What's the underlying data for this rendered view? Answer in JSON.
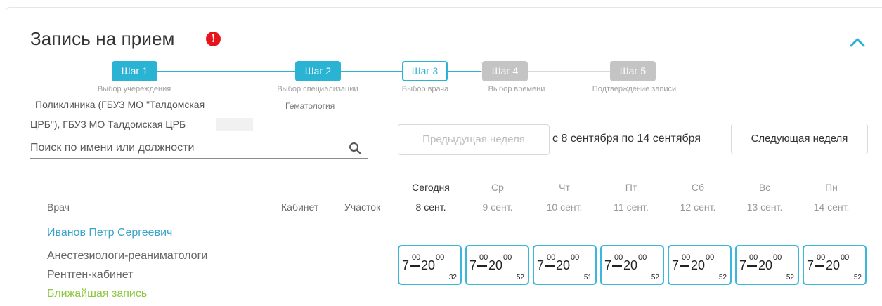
{
  "header": {
    "title": "Запись на прием",
    "info_icon": "info-icon",
    "collapse_icon": "chevron-up-icon",
    "accent_color": "#2bb3d4",
    "info_color": "#e8141c"
  },
  "steps": [
    {
      "label": "Шаг 1",
      "caption": "Выбор учереждения",
      "state": "done"
    },
    {
      "label": "Шаг 2",
      "caption": "Выбор специализации",
      "state": "done"
    },
    {
      "label": "Шаг 3",
      "caption": "Выбор врача",
      "state": "current"
    },
    {
      "label": "Шаг 4",
      "caption": "Выбор времени",
      "state": "todo"
    },
    {
      "label": "Шаг 5",
      "caption": "Подтверждение записи",
      "state": "todo"
    }
  ],
  "selection": {
    "clinic_line1": "Поликлиника (ГБУЗ МО \"Талдомская",
    "clinic_line2": "ЦРБ\"), ГБУЗ МО Талдомская ЦРБ",
    "specialization": "Гематология"
  },
  "search": {
    "placeholder": "Поиск по имени или должности",
    "value": ""
  },
  "week": {
    "prev_label": "Предыдущая неделя",
    "range": "с 8 сентября по 14 сентября",
    "next_label": "Следующая неделя"
  },
  "table": {
    "col_doctor": "Врач",
    "col_room": "Кабинет",
    "col_area": "Участок",
    "days": [
      {
        "name": "Сегодня",
        "date": "8 сент.",
        "today": true
      },
      {
        "name": "Ср",
        "date": "9 сент."
      },
      {
        "name": "Чт",
        "date": "10 сент."
      },
      {
        "name": "Пт",
        "date": "11 сент."
      },
      {
        "name": "Сб",
        "date": "12 сент."
      },
      {
        "name": "Вс",
        "date": "13 сент."
      },
      {
        "name": "Пн",
        "date": "14 сент."
      }
    ]
  },
  "doctor": {
    "name": "Иванов Петр Сергеевич",
    "specialty": "Анестезиологи-реаниматологи",
    "room": "Рентген-кабинет",
    "nearest_label": "Ближайшая запись",
    "slots": [
      {
        "from_h": "7",
        "from_m": "00",
        "to_h": "20",
        "to_m": "00",
        "count": "32"
      },
      {
        "from_h": "7",
        "from_m": "00",
        "to_h": "20",
        "to_m": "00",
        "count": "52"
      },
      {
        "from_h": "7",
        "from_m": "00",
        "to_h": "20",
        "to_m": "00",
        "count": "51"
      },
      {
        "from_h": "7",
        "from_m": "00",
        "to_h": "20",
        "to_m": "00",
        "count": "52"
      },
      {
        "from_h": "7",
        "from_m": "00",
        "to_h": "20",
        "to_m": "00",
        "count": "52"
      },
      {
        "from_h": "7",
        "from_m": "00",
        "to_h": "20",
        "to_m": "00",
        "count": "52"
      },
      {
        "from_h": "7",
        "from_m": "00",
        "to_h": "20",
        "to_m": "00",
        "count": "52"
      }
    ]
  }
}
